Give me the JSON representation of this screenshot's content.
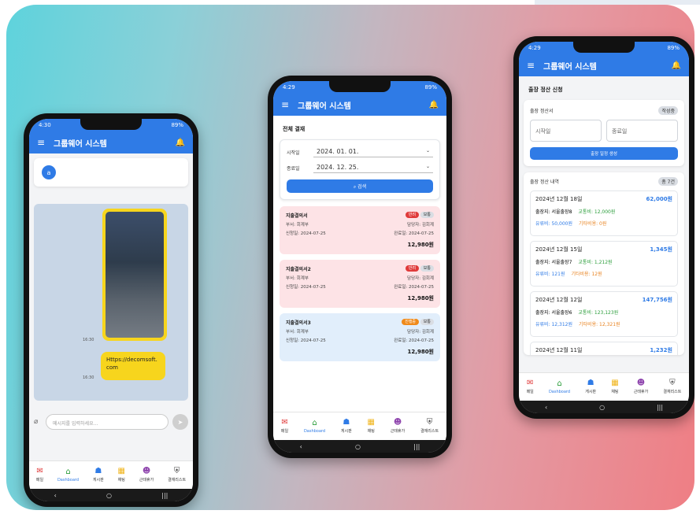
{
  "app_title": "그룹웨어 시스템",
  "phone1": {
    "status_time": "4:30",
    "status_right": "89%",
    "avatar_letter": "a",
    "msg_time1": "16:30",
    "msg_text": "Https://decomsoft.com",
    "msg_time2": "16:30",
    "input_placeholder": "메시지를 입력하세요..."
  },
  "phone2": {
    "status_time": "4:29",
    "status_right": "89%",
    "section_title": "전체 결재",
    "start_label": "시작일",
    "start_value": "2024. 01. 01.",
    "end_label": "종료일",
    "end_value": "2024. 12. 25.",
    "search_label": "검색",
    "docs": [
      {
        "title": "지출결의서",
        "badge": "반려",
        "badge2": "보통",
        "dept": "부서: 회계부",
        "author": "담당자: 김회계",
        "applied": "신청일: 2024-07-25",
        "done": "완료일: 2024-07-25",
        "amount": "12,980원"
      },
      {
        "title": "지출결의서2",
        "badge": "반려",
        "badge2": "보통",
        "dept": "부서: 회계부",
        "author": "담당자: 김회계",
        "applied": "신청일: 2024-07-25",
        "done": "완료일: 2024-07-25",
        "amount": "12,980원"
      },
      {
        "title": "지출결의서3",
        "badge": "진행중",
        "badge2": "보통",
        "dept": "부서: 회계부",
        "author": "담당자: 김회계",
        "applied": "신청일: 2024-07-25",
        "done": "완료일: 2024-07-25",
        "amount": "12,980원"
      }
    ]
  },
  "phone3": {
    "status_time": "4:29",
    "status_right": "89%",
    "section_title": "출장 정산 신청",
    "form_title": "출장 정산서",
    "form_badge": "작성중",
    "start_placeholder": "시작일",
    "end_placeholder": "종료일",
    "submit_label": "출장 일정 생성",
    "list_title": "출장 정산 내역",
    "list_count": "총 7건",
    "items": [
      {
        "date": "2024년 12월 18일",
        "amount": "62,000원",
        "place": "출장지: 서울출장8",
        "transport": "교통비: 12,000원",
        "fuel": "유류비: 50,000원",
        "etc": "기타비용: 0원"
      },
      {
        "date": "2024년 12월 15일",
        "amount": "1,345원",
        "place": "출장지: 서울출장7",
        "transport": "교통비: 1,212원",
        "fuel": "유류비: 121원",
        "etc": "기타비용: 12원"
      },
      {
        "date": "2024년 12월 12일",
        "amount": "147,756원",
        "place": "출장지: 서울출장6",
        "transport": "교통비: 123,123원",
        "fuel": "유류비: 12,312원",
        "etc": "기타비용: 12,321원"
      },
      {
        "date": "2024년 12월 11일",
        "amount": "1,232원",
        "place": "",
        "transport": "",
        "fuel": "",
        "etc": ""
      }
    ]
  },
  "nav": [
    "메일",
    "Dashboard",
    "게시판",
    "채팅",
    "근태휴가",
    "결재리스트"
  ],
  "nav_icons": [
    "mail-icon",
    "home-icon",
    "board-icon",
    "chat-icon",
    "attendance-icon",
    "approval-icon"
  ],
  "colors": {
    "primary": "#2f7be6",
    "reject": "#e03a3a",
    "progress": "#f08a1a"
  }
}
